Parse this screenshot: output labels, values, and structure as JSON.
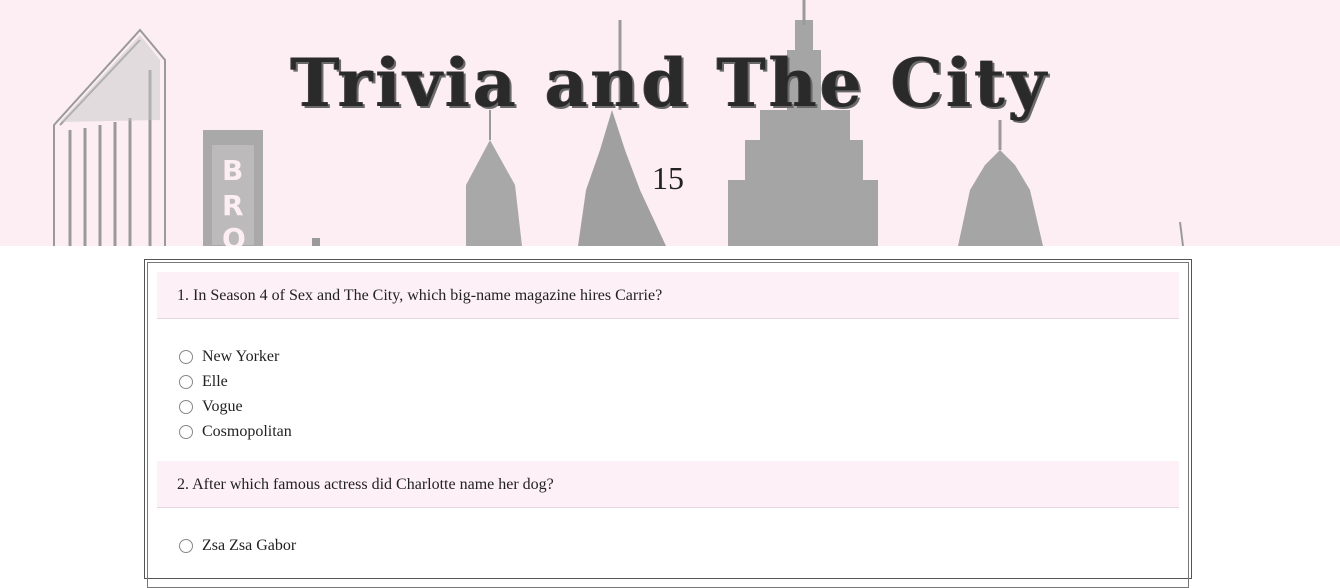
{
  "header": {
    "title": "Trivia and The City",
    "score": "15"
  },
  "questions": [
    {
      "text": "1. In Season 4 of Sex and The City, which big-name magazine hires Carrie?",
      "options": [
        "New Yorker",
        "Elle",
        "Vogue",
        "Cosmopolitan"
      ]
    },
    {
      "text": "2. After which famous actress did Charlotte name her dog?",
      "options": [
        "Zsa Zsa Gabor"
      ]
    }
  ],
  "colors": {
    "header_bg": "#fdeef3",
    "question_bg": "#fdf0f6",
    "skyline": "#9a9a9a"
  }
}
